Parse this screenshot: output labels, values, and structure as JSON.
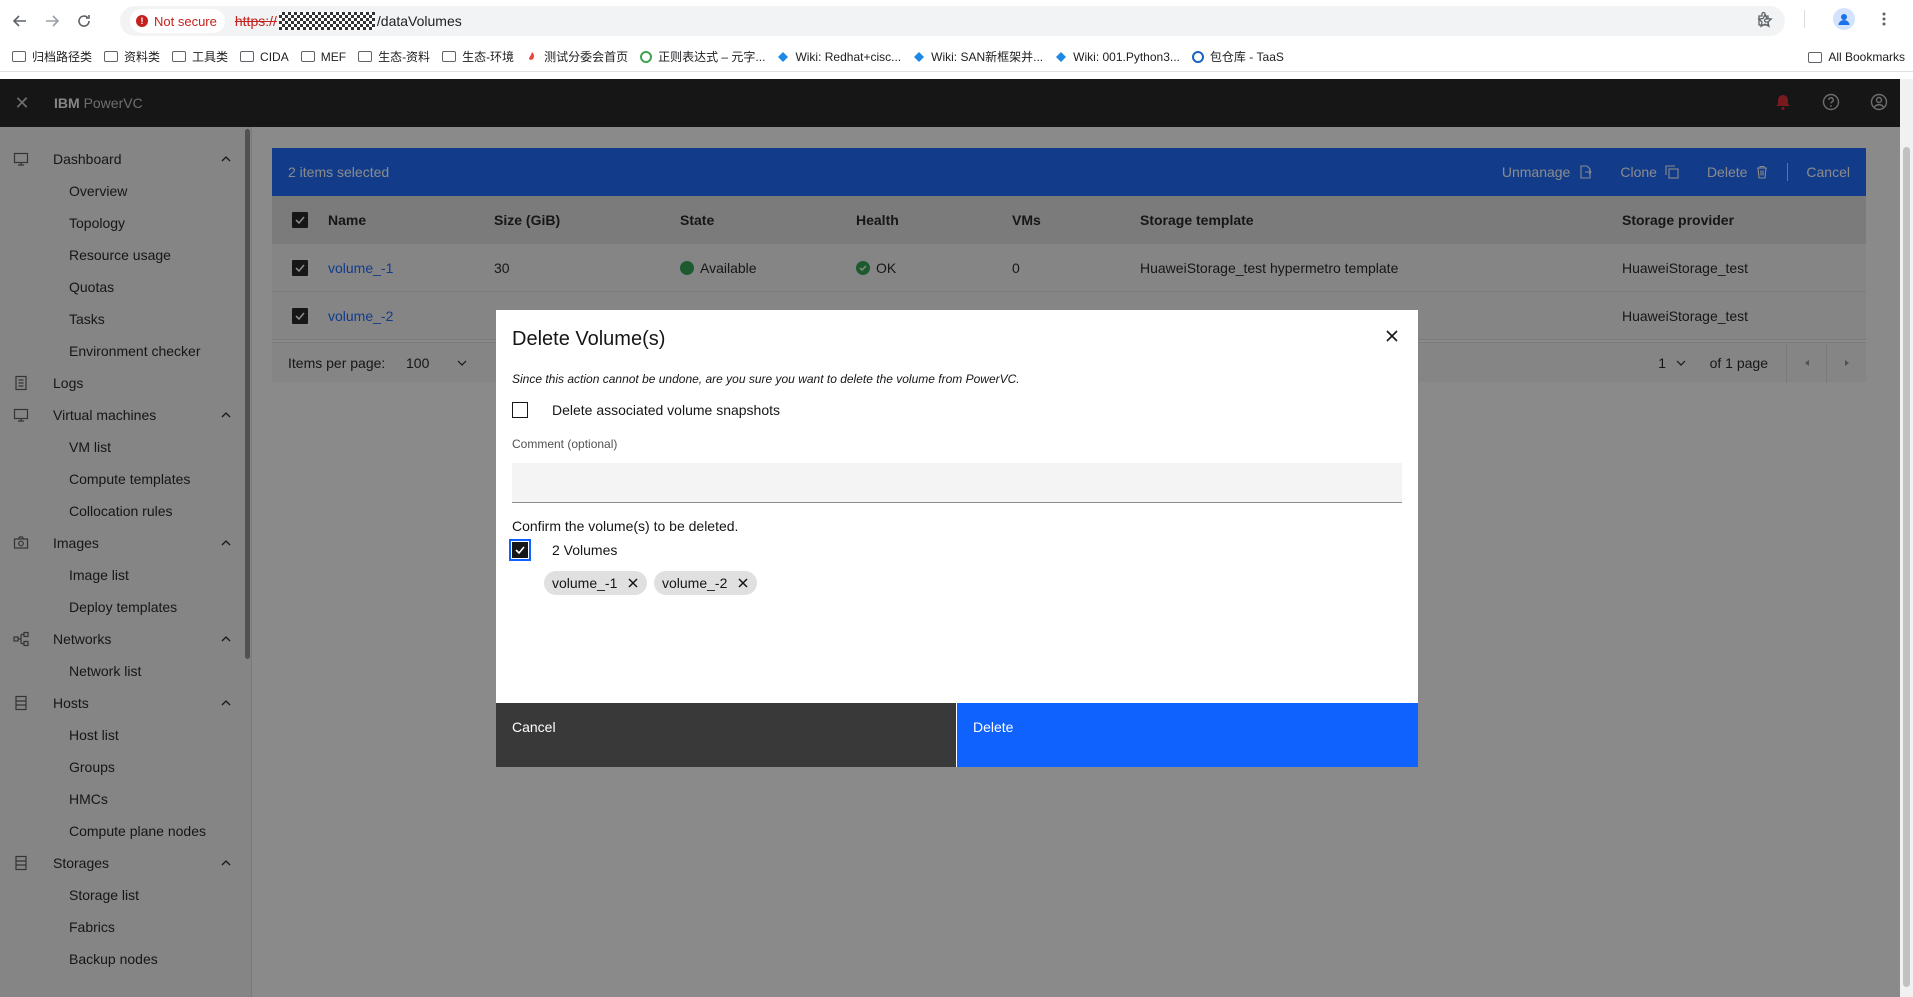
{
  "browser": {
    "security_label": "Not secure",
    "url_scheme": "https://",
    "url_path": "/dataVolumes",
    "bookmarks": [
      "归档路径类",
      "资料类",
      "工具类",
      "CIDA",
      "MEF",
      "生态-资料",
      "生态-环境",
      "测试分委会首页",
      "正则表达式 – 元字...",
      "Wiki: Redhat+cisc...",
      "Wiki: SAN新框架并...",
      "Wiki: 001.Python3...",
      "包仓库 - TaaS"
    ],
    "all_bookmarks": "All Bookmarks"
  },
  "app": {
    "brand": "IBM",
    "product": "PowerVC"
  },
  "sidebar": {
    "sections": [
      {
        "label": "Dashboard",
        "items": [
          "Overview",
          "Topology",
          "Resource usage",
          "Quotas",
          "Tasks",
          "Environment checker"
        ]
      },
      {
        "label": "Logs",
        "items": []
      },
      {
        "label": "Virtual machines",
        "items": [
          "VM list",
          "Compute templates",
          "Collocation rules"
        ]
      },
      {
        "label": "Images",
        "items": [
          "Image list",
          "Deploy templates"
        ]
      },
      {
        "label": "Networks",
        "items": [
          "Network list"
        ]
      },
      {
        "label": "Hosts",
        "items": [
          "Host list",
          "Groups",
          "HMCs",
          "Compute plane nodes"
        ]
      },
      {
        "label": "Storages",
        "items": [
          "Storage list",
          "Fabrics",
          "Backup nodes"
        ]
      }
    ]
  },
  "selection_bar": {
    "count_text": "2 items selected",
    "actions": {
      "unmanage": "Unmanage",
      "clone": "Clone",
      "delete": "Delete",
      "cancel": "Cancel"
    }
  },
  "table": {
    "headers": [
      "Name",
      "Size (GiB)",
      "State",
      "Health",
      "VMs",
      "Storage template",
      "Storage provider"
    ],
    "rows": [
      {
        "name": "volume_-1",
        "size": "30",
        "state": "Available",
        "health": "OK",
        "vms": "0",
        "template": "HuaweiStorage_test hypermetro template",
        "provider": "HuaweiStorage_test"
      },
      {
        "name": "volume_-2",
        "size": "",
        "state": "",
        "health": "",
        "vms": "",
        "template": "",
        "provider": "HuaweiStorage_test"
      }
    ]
  },
  "pagination": {
    "items_per_page_label": "Items per page:",
    "items_per_page": "100",
    "page": "1",
    "of_pages": "of 1 page"
  },
  "modal": {
    "title": "Delete Volume(s)",
    "message": "Since this action cannot be undone, are you sure you want to delete the volume from PowerVC.",
    "snapshot_label": "Delete associated volume snapshots",
    "comment_label": "Comment (optional)",
    "comment_value": "",
    "confirm_text": "Confirm the volume(s) to be deleted.",
    "volumes_label": "2 Volumes",
    "tags": [
      "volume_-1",
      "volume_-2"
    ],
    "cancel": "Cancel",
    "delete": "Delete"
  },
  "colors": {
    "accent": "#0f62fe",
    "header_bg": "#161616",
    "success": "#24a148",
    "notification": "#da1e28"
  }
}
